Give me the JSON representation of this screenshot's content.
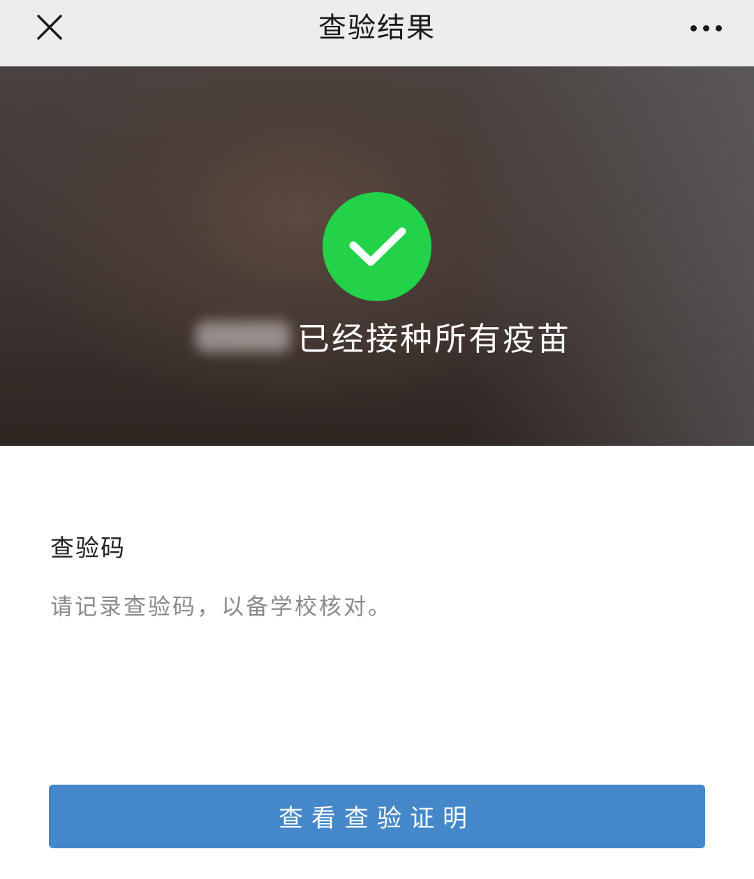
{
  "header": {
    "title": "查验结果",
    "close_icon": "close-icon",
    "more_icon": "more-dots-icon"
  },
  "result": {
    "status_icon": "checkmark-icon",
    "status_color": "#22d34a",
    "status_text": "已经接种所有疫苗"
  },
  "code_section": {
    "label": "查验码",
    "hint": "请记录查验码，以备学校核对。"
  },
  "actions": {
    "view_certificate_label": "查看查验证明",
    "button_color": "#4488c9"
  }
}
